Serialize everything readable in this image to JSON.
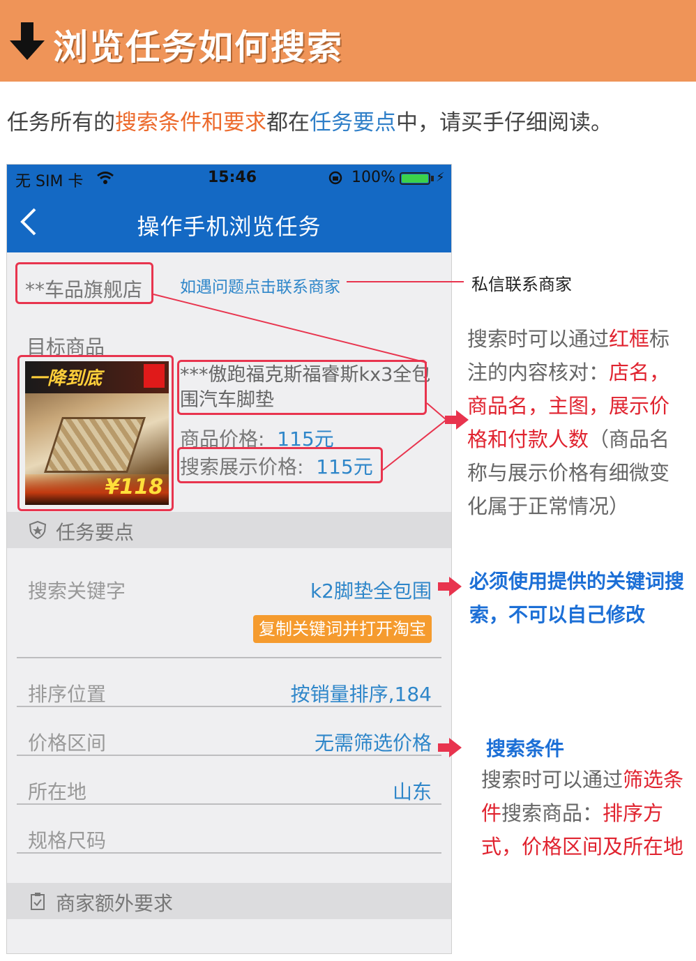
{
  "banner": {
    "title": "浏览任务如何搜索",
    "icon": "down-arrow-icon"
  },
  "intro": {
    "part1": "任务所有的",
    "part2": "搜索条件和要求",
    "part3": "都在",
    "part4": "任务要点",
    "part5": "中，请买手仔细阅读。"
  },
  "phone": {
    "status": {
      "carrier": "无 SIM 卡",
      "time": "15:46",
      "battery": "100%"
    },
    "nav": {
      "title": "操作手机浏览任务"
    },
    "shop_name": "**车品旗舰店",
    "contact_link": "如遇问题点击联系商家",
    "target_label": "目标商品",
    "thumb": {
      "banner": "一降到底",
      "price": "¥118"
    },
    "product": {
      "title": "***傲跑福克斯福睿斯kx3全包围汽车脚垫",
      "price_label": "商品价格:",
      "price_value": "115元",
      "search_price_label": "搜索展示价格:",
      "search_price_value": "115元"
    },
    "task_points_label": "任务要点",
    "keyword": {
      "label": "搜索关键字",
      "value": "k2脚垫全包围",
      "copy_button": "复制关键词并打开淘宝"
    },
    "sort": {
      "label": "排序位置",
      "value": "按销量排序,184"
    },
    "price_range": {
      "label": "价格区间",
      "value": "无需筛选价格"
    },
    "location": {
      "label": "所在地",
      "value": "山东"
    },
    "spec": {
      "label": "规格尺码",
      "value": ""
    },
    "extra_label": "商家额外要求"
  },
  "notes": {
    "contact": "私信联系商家",
    "verify": {
      "l1a": "搜索时可以通过",
      "l1b": "红框",
      "l1c": "标",
      "l2a": "注的内容核对：",
      "l2b": "店名，",
      "l3": "商品名，主图，展示价",
      "l4a": "格和付款人数",
      "l4b": "（商品名",
      "l5": "称与展示价格有细微变",
      "l6": "化属于正常情况）"
    },
    "keyword": {
      "l1": "必须使用提供的关键词搜",
      "l2": "索，不可以自己修改"
    },
    "filter": {
      "title": "搜索条件",
      "l1a": "搜索时可以通过",
      "l1b": "筛选条",
      "l2a": "件",
      "l2b": "搜索商品：",
      "l2c": "排序方",
      "l3": "式，价格区间及所在地"
    }
  },
  "colors": {
    "banner": "#ef9458",
    "nav": "#1469c4",
    "accent_red": "#e8344e",
    "link_blue": "#2e86c9",
    "button_orange": "#f59b2e"
  }
}
